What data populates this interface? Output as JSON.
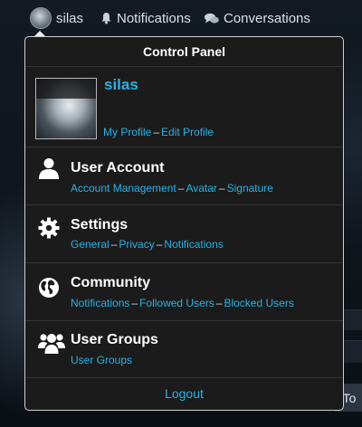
{
  "nav": {
    "username": "silas",
    "notifications_label": "Notifications",
    "conversations_label": "Conversations"
  },
  "panel": {
    "title": "Control Panel",
    "profile": {
      "name": "silas",
      "my_profile": "My Profile",
      "edit_profile": "Edit Profile"
    },
    "sections": {
      "account": {
        "title": "User Account",
        "links": [
          "Account Management",
          "Avatar",
          "Signature"
        ]
      },
      "settings": {
        "title": "Settings",
        "links": [
          "General",
          "Privacy",
          "Notifications"
        ]
      },
      "community": {
        "title": "Community",
        "links": [
          "Notifications",
          "Followed Users",
          "Blocked Users"
        ]
      },
      "groups": {
        "title": "User Groups",
        "links": [
          "User Groups"
        ]
      }
    },
    "logout": "Logout"
  },
  "background": {
    "fragment_text": "y To"
  },
  "icons": {
    "nav_bell": "bell-icon",
    "nav_chat": "chat-bubbles-icon",
    "account": "user-icon",
    "settings": "gear-icon",
    "community": "globe-icon",
    "groups": "group-icon"
  },
  "colors": {
    "link": "#27b2e6",
    "panel_bg": "#1b1b1b",
    "panel_border": "#cfcfcf"
  }
}
